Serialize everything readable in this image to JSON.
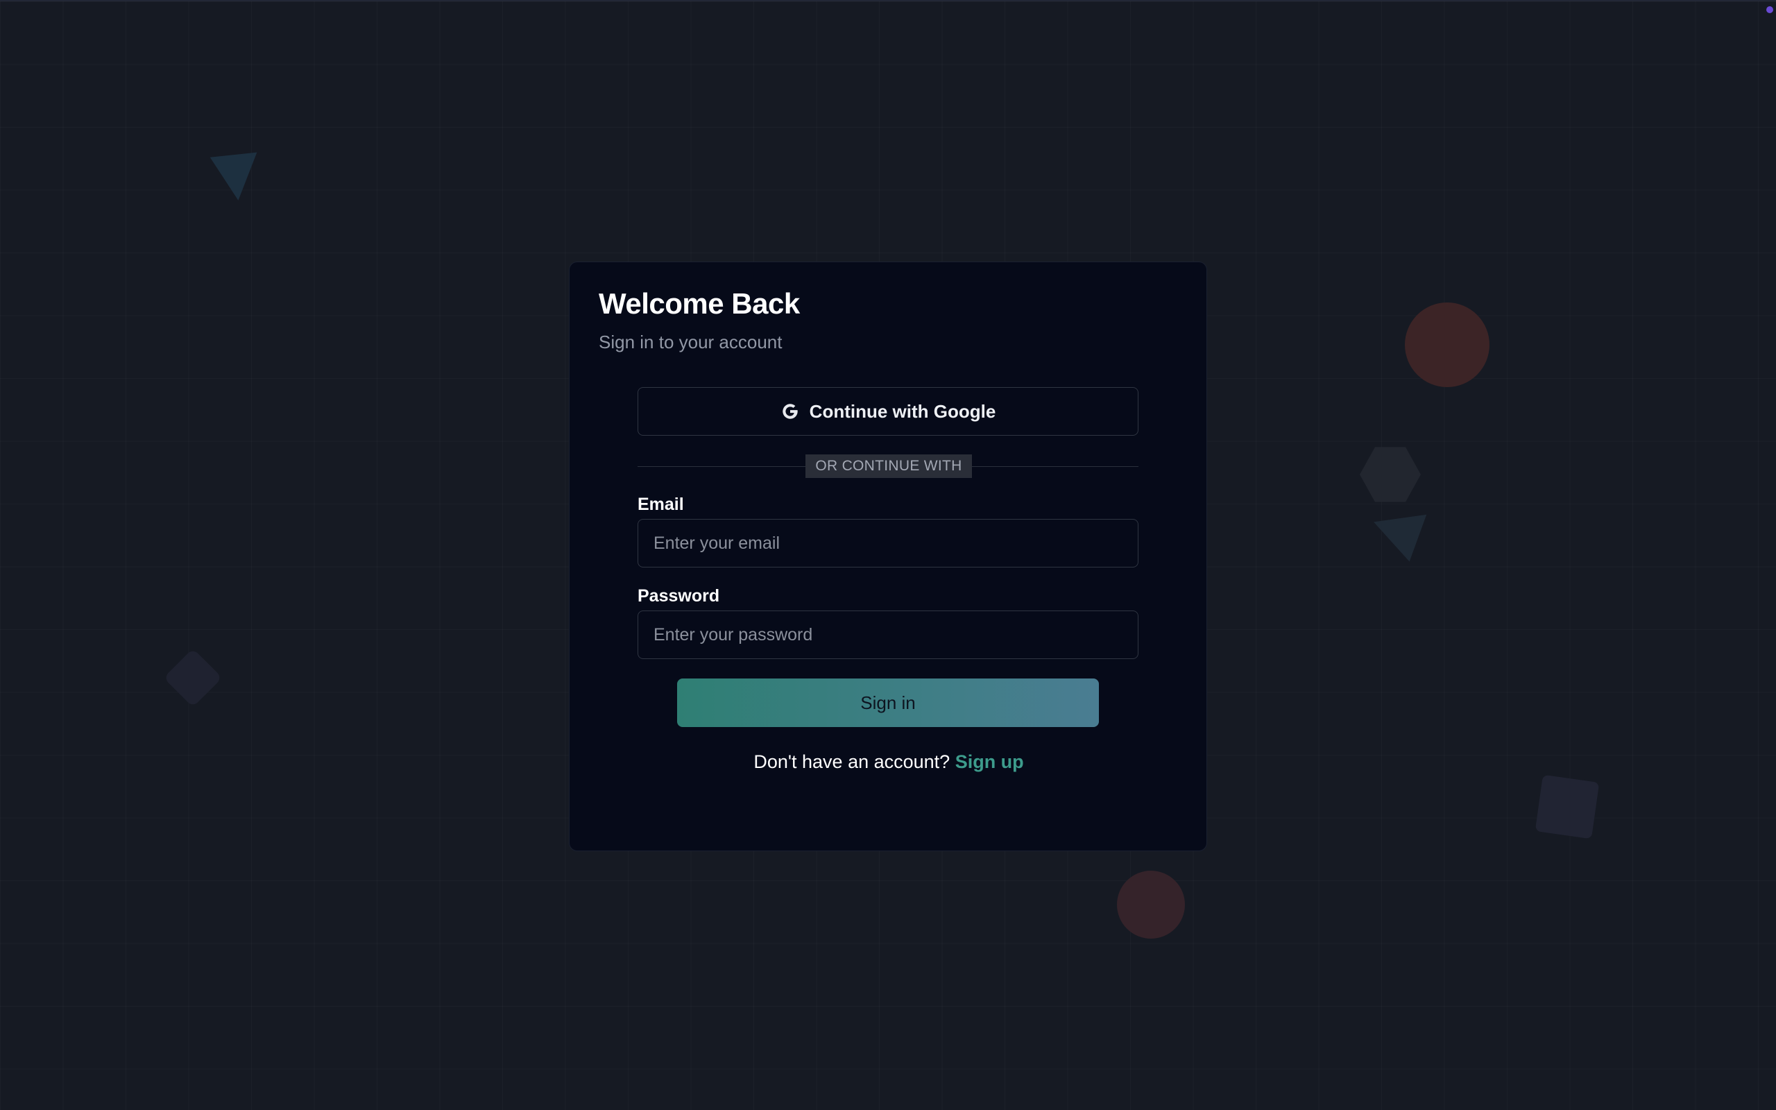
{
  "login": {
    "title": "Welcome Back",
    "subtitle": "Sign in to your account",
    "google_button_label": "Continue with Google",
    "divider_label": "OR CONTINUE WITH",
    "email": {
      "label": "Email",
      "placeholder": "Enter your email",
      "value": ""
    },
    "password": {
      "label": "Password",
      "placeholder": "Enter your password",
      "value": ""
    },
    "submit_label": "Sign in",
    "signup_prompt": "Don't have an account?",
    "signup_link": "Sign up"
  },
  "icons": {
    "google": "google-icon"
  },
  "colors": {
    "background": "#161a23",
    "card": "#060a19",
    "accent": "#3d9c8c",
    "button_gradient_start": "#2f7f74",
    "button_gradient_end": "#4a7d92"
  }
}
